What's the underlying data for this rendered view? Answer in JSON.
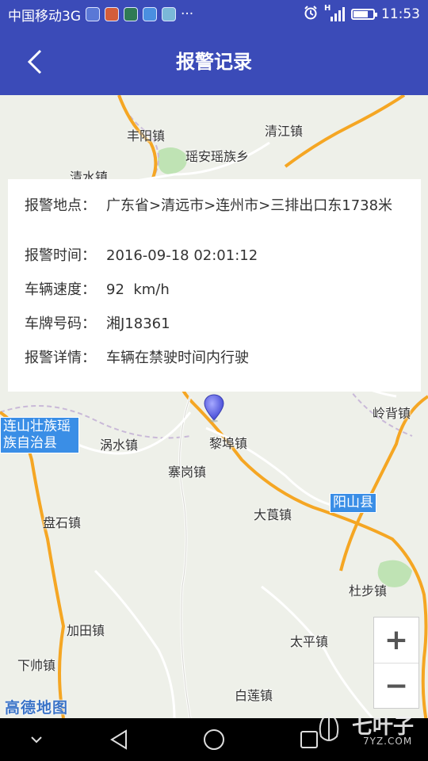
{
  "status_bar": {
    "carrier": "中国移动3G",
    "network_indicator": "H",
    "time": "11:53",
    "more": "···",
    "battery_level": 0.75
  },
  "app_bar": {
    "title": "报警记录"
  },
  "alarm": {
    "location_label": "报警地点：",
    "location_value": "广东省>清远市>连州市>三排出口东1738米",
    "time_label": "报警时间：",
    "time_value": "2016-09-18 02:01:12",
    "speed_label": "车辆速度：",
    "speed_value": "92  km/h",
    "plate_label": "车牌号码：",
    "plate_value": "湘J18361",
    "detail_label": "报警详情：",
    "detail_value": "车辆在禁驶时间内行驶"
  },
  "map": {
    "places": {
      "fengyang": "丰阳镇",
      "qingjiang": "清江镇",
      "yaoan": "瑶安瑶族乡",
      "qingshui": "清水镇",
      "lingbei": "岭背镇",
      "wo_shui": "涡水镇",
      "libu": "黎埠镇",
      "saigang": "寨岗镇",
      "dagang": "大莨镇",
      "panshi": "盘石镇",
      "dubu": "杜步镇",
      "jiatian": "加田镇",
      "taiping": "太平镇",
      "xiashuai": "下帅镇",
      "bailian": "白莲镇"
    },
    "counties": {
      "lianshan": "连山壮族瑶族自治县",
      "yangshan": "阳山县"
    },
    "logo": "高德地图",
    "zoom_in": "+",
    "zoom_out": "−"
  },
  "watermark": {
    "main": "七叶子",
    "sub": "7YZ.COM"
  }
}
